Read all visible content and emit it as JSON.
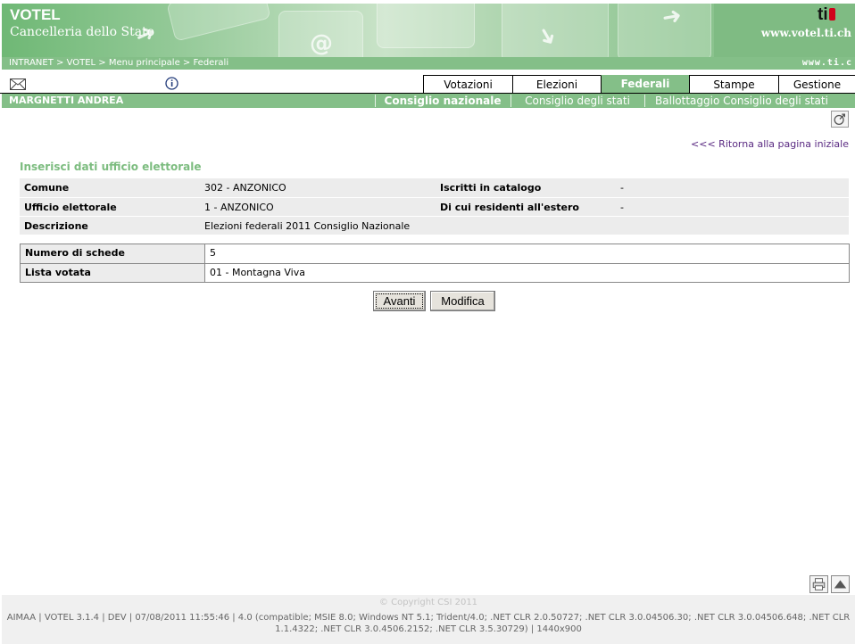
{
  "header": {
    "app_title": "VOTEL",
    "app_subtitle": "Cancelleria dello Stato",
    "logo_text": "ti",
    "site_url": "www.votel.ti.ch",
    "secondary_url": "www.ti.c",
    "breadcrumb": "INTRANET > VOTEL > Menu principale > Federali"
  },
  "nav": {
    "tabs": [
      {
        "label": "Votazioni",
        "active": false
      },
      {
        "label": "Elezioni",
        "active": false
      },
      {
        "label": "Federali",
        "active": true
      },
      {
        "label": "Stampe",
        "active": false
      },
      {
        "label": "Gestione",
        "active": false
      }
    ],
    "user_name": "MARGNETTI ANDREA",
    "subtabs": [
      {
        "label": "Consiglio nazionale",
        "active": true
      },
      {
        "label": "Consiglio degli stati",
        "active": false
      },
      {
        "label": "Ballottaggio Consiglio degli stati",
        "active": false
      }
    ]
  },
  "main": {
    "back_link": "<<< Ritorna alla pagina iniziale",
    "section_title": "Inserisci dati ufficio elettorale",
    "info": [
      {
        "label": "Comune",
        "value": "302 - ANZONICO",
        "label2": "Iscritti in catalogo",
        "value2": "-"
      },
      {
        "label": "Ufficio elettorale",
        "value": "1 - ANZONICO",
        "label2": "Di cui residenti all'estero",
        "value2": "-"
      },
      {
        "label": "Descrizione",
        "value": "Elezioni federali 2011 Consiglio Nazionale",
        "label2": "",
        "value2": ""
      }
    ],
    "form": [
      {
        "label": "Numero di schede",
        "value": "5"
      },
      {
        "label": "Lista votata",
        "value": "01 - Montagna Viva"
      }
    ],
    "buttons": {
      "next": "Avanti",
      "edit": "Modifica"
    }
  },
  "footer": {
    "copyright": "© Copyright CSI 2011",
    "info": "AIMAA | VOTEL 3.1.4 | DEV | 07/08/2011 11:55:46 | 4.0 (compatible; MSIE 8.0; Windows NT 5.1; Trident/4.0; .NET CLR 2.0.50727; .NET CLR 3.0.04506.30; .NET CLR 3.0.04506.648; .NET CLR 1.1.4322; .NET CLR 3.0.4506.2152; .NET CLR 3.5.30729) | 1440x900"
  },
  "colors": {
    "brand_green": "#84bf88",
    "title_green": "#7cbc7f",
    "link_purple": "#5a2a82"
  }
}
